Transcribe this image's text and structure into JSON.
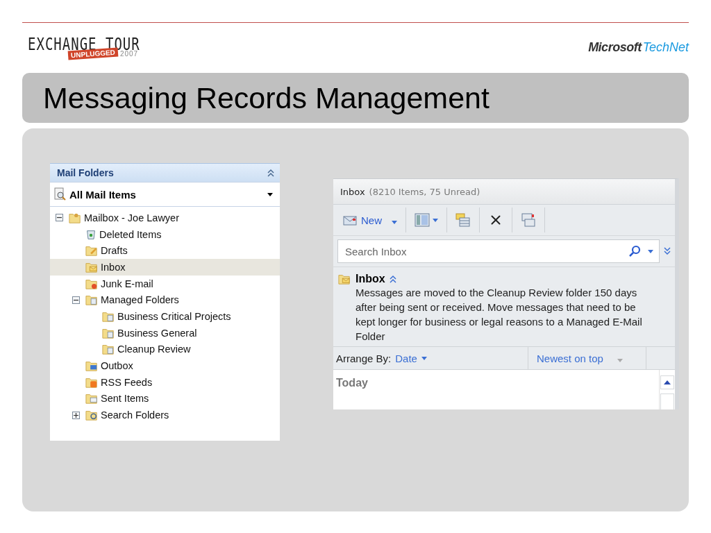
{
  "slide": {
    "logo": {
      "title": "EXCHANGE TOUR",
      "badge": "UNPLUGGED",
      "year": "2007"
    },
    "brand": {
      "company": "Microsoft",
      "product": "TechNet"
    },
    "title": "Messaging Records Management"
  },
  "folder_pane": {
    "header": "Mail Folders",
    "view": "All Mail Items",
    "tree": [
      {
        "label": "Mailbox - Joe Lawyer",
        "kind": "mailbox",
        "selected": false,
        "expanded": true,
        "children": [
          {
            "label": "Deleted Items",
            "kind": "trash",
            "selected": false
          },
          {
            "label": "Drafts",
            "kind": "drafts",
            "selected": false
          },
          {
            "label": "Inbox",
            "kind": "inbox",
            "selected": true
          },
          {
            "label": "Junk E-mail",
            "kind": "junk",
            "selected": false
          },
          {
            "label": "Managed Folders",
            "kind": "managed",
            "selected": false,
            "expanded": true,
            "children": [
              {
                "label": "Business Critical Projects",
                "kind": "managed",
                "selected": false
              },
              {
                "label": "Business General",
                "kind": "managed",
                "selected": false
              },
              {
                "label": "Cleanup Review",
                "kind": "managed",
                "selected": false
              }
            ]
          },
          {
            "label": "Outbox",
            "kind": "outbox",
            "selected": false
          },
          {
            "label": "RSS Feeds",
            "kind": "rss",
            "selected": false
          },
          {
            "label": "Sent Items",
            "kind": "sent",
            "selected": false
          },
          {
            "label": "Search Folders",
            "kind": "search",
            "selected": false,
            "expanded": false
          }
        ]
      }
    ]
  },
  "inbox_pane": {
    "title": "Inbox",
    "count": "(8210 Items, 75 Unread)",
    "toolbar": [
      {
        "kind": "new",
        "label": "New"
      },
      {
        "kind": "reading-pane"
      },
      {
        "kind": "move"
      },
      {
        "kind": "delete"
      },
      {
        "kind": "address-book"
      }
    ],
    "search": {
      "placeholder": "Search Inbox"
    },
    "policy": {
      "folder": "Inbox",
      "message": "Messages are moved to the Cleanup Review folder 150 days after being sent or received. Move messages that need to be kept longer for business or legal reasons to a Managed E-Mail Folder"
    },
    "arrange": {
      "label": "Arrange By:",
      "field": "Date",
      "order": "Newest on top"
    },
    "group": "Today"
  }
}
